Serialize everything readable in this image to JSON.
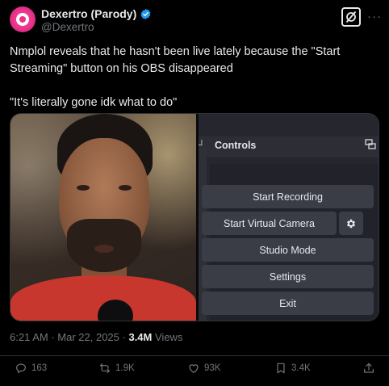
{
  "author": {
    "display_name": "Dexertro (Parody)",
    "handle": "@Dexertro"
  },
  "tweet": {
    "paragraph1": "Nmplol reveals that he hasn't been live lately because the \"Start Streaming\" button on his OBS disappeared",
    "paragraph2": "\"It's literally gone idk what to do\""
  },
  "obs": {
    "dock_title": "Controls",
    "buttons": [
      "Start Recording",
      "Start Virtual Camera",
      "Studio Mode",
      "Settings",
      "Exit"
    ]
  },
  "meta": {
    "time": "6:21 AM",
    "date": "Mar 22, 2025",
    "views_count": "3.4M",
    "views_label": "Views"
  },
  "actions": {
    "replies": "163",
    "reposts": "1.9K",
    "likes": "93K",
    "bookmarks": "3.4K"
  },
  "colors": {
    "accent": "#1d9bf0",
    "obs_button": "#3a3c46",
    "text_muted": "#71767b"
  }
}
